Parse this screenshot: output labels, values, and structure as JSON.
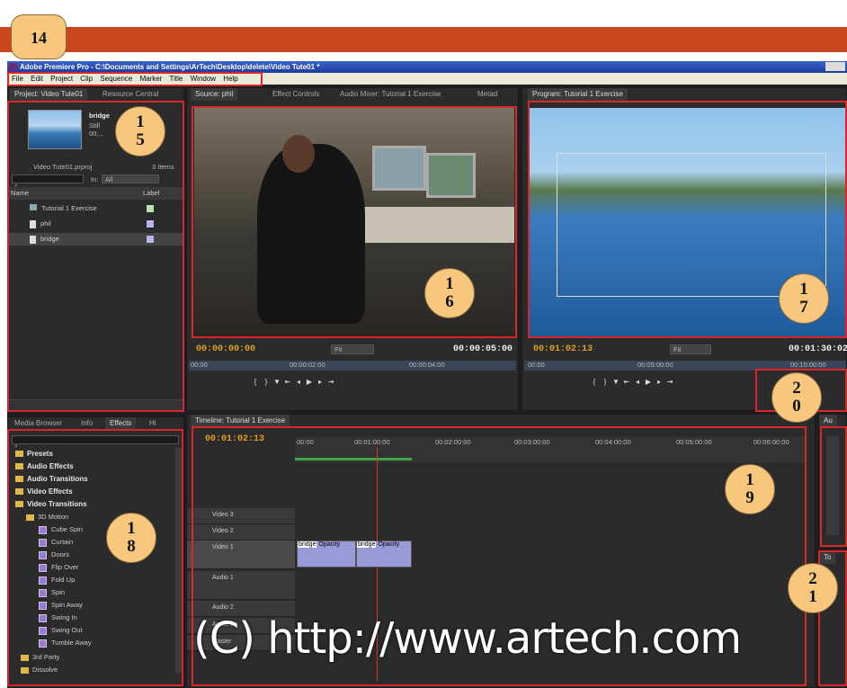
{
  "page": {
    "number": "14"
  },
  "titlebar": {
    "text": "Adobe Premiere Pro - C:\\Documents and Settings\\ArTech\\Desktop\\delete\\Video Tute01 *"
  },
  "menu": [
    "File",
    "Edit",
    "Project",
    "Clip",
    "Sequence",
    "Marker",
    "Title",
    "Window",
    "Help"
  ],
  "project": {
    "tabs": [
      "Project: Video Tute01",
      "Resource Central"
    ],
    "preview_name": "bridge",
    "preview_type": "Still",
    "preview_dur": "00;...",
    "file": "Video Tute01.prproj",
    "items": "3 Items",
    "in_label": "In:",
    "in_value": "All",
    "col_name": "Name",
    "col_label": "Label",
    "rows": [
      "Tutorial 1 Exercise",
      "phil",
      "bridge"
    ]
  },
  "source": {
    "tabs": [
      "Source: phil",
      "Effect Controls",
      "Audio Mixer: Tutorial 1 Exercise",
      "Metad"
    ],
    "tc_in": "00:00:00:00",
    "fit": "Fit",
    "tc_dur": "00:00:05:00",
    "ruler": [
      "00:00",
      "00:00:02:00",
      "00:00:04:00"
    ]
  },
  "program": {
    "tab": "Program: Tutorial 1 Exercise",
    "tc_in": "00:01:02:13",
    "fit": "Fit",
    "tc_dur": "00:01:30:02",
    "ruler": [
      "00:00",
      "00:05:00:00",
      "00:10:00:00"
    ]
  },
  "effects": {
    "tabs": [
      "Media Browser",
      "Info",
      "Effects",
      "Hi"
    ],
    "folders": [
      "Presets",
      "Audio Effects",
      "Audio Transitions",
      "Video Effects",
      "Video Transitions"
    ],
    "sub": "3D Motion",
    "items": [
      "Cube Spin",
      "Curtain",
      "Doors",
      "Flip Over",
      "Fold Up",
      "Spin",
      "Spin Away",
      "Swing In",
      "Swing Out",
      "Tumble Away"
    ],
    "more": [
      "3rd Party",
      "Dissolve"
    ]
  },
  "timeline": {
    "tab": "Timeline: Tutorial 1 Exercise",
    "tc": "00:01:02:13",
    "ruler": [
      "00:00",
      "00:01:00:00",
      "00:02:00:00",
      "00:03:00:00",
      "00:04:00:00",
      "00:05:00:00",
      "00:06:00:00"
    ],
    "tracks": [
      "Video 3",
      "Video 2",
      "Video 1",
      "Audio 1",
      "Audio 2",
      "Audio 3",
      "Master"
    ],
    "clip1": "bridge",
    "clip1fx": "Opacity",
    "clip2": "bridge",
    "clip2fx": "Opacity"
  },
  "audio_meter": {
    "tab": "Au"
  },
  "tools": {
    "tab": "To"
  },
  "badges": [
    "1\n5",
    "1\n6",
    "1\n7",
    "2\n0",
    "1\n8",
    "1\n9",
    "2\n1"
  ],
  "watermark": "(C) http://www.artech.com"
}
